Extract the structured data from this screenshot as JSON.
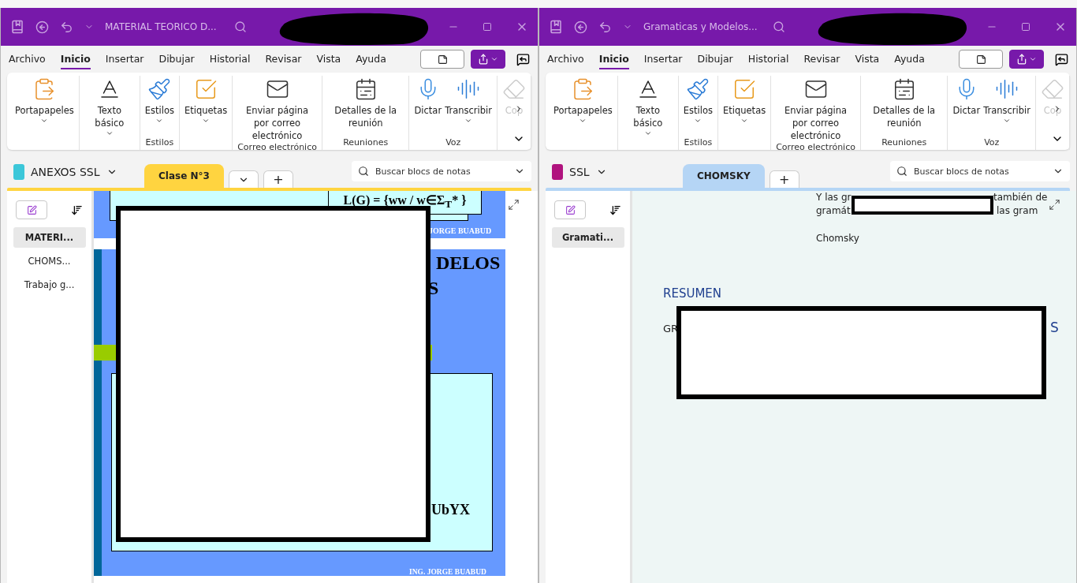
{
  "windows": [
    {
      "title": "MATERIAL TEORICO D...",
      "menu_tabs": [
        {
          "label": "Archivo",
          "selected": false
        },
        {
          "label": "Inicio",
          "selected": true
        },
        {
          "label": "Insertar",
          "selected": false
        },
        {
          "label": "Dibujar",
          "selected": false
        },
        {
          "label": "Historial",
          "selected": false
        },
        {
          "label": "Revisar",
          "selected": false
        },
        {
          "label": "Vista",
          "selected": false
        },
        {
          "label": "Ayuda",
          "selected": false
        }
      ],
      "ribbon_groups": [
        {
          "buttons": [
            {
              "kind": "clipboard",
              "label": "Portapapeles",
              "dropdown": true,
              "disabled": false
            }
          ]
        },
        {
          "buttons": [
            {
              "kind": "text",
              "label": "Texto básico",
              "dropdown": true,
              "disabled": false
            }
          ]
        },
        {
          "caption": "Estilos",
          "buttons": [
            {
              "kind": "styles",
              "label": "Estilos",
              "dropdown": true,
              "disabled": false
            }
          ]
        },
        {
          "buttons": [
            {
              "kind": "tags",
              "label": "Etiquetas",
              "dropdown": true,
              "disabled": false
            }
          ]
        },
        {
          "caption": "Correo electrónico",
          "buttons": [
            {
              "kind": "mail",
              "label": "Enviar página por correo electrónico",
              "dropdown": false,
              "disabled": false
            }
          ]
        },
        {
          "caption": "Reuniones",
          "buttons": [
            {
              "kind": "meeting",
              "label": "Detalles de la reunión",
              "dropdown": false,
              "disabled": false
            }
          ]
        },
        {
          "caption": "Voz",
          "buttons": [
            {
              "kind": "dictate",
              "label": "Dictar",
              "dropdown": false,
              "disabled": false
            },
            {
              "kind": "transcribe",
              "label": "Transcribir",
              "dropdown": true,
              "disabled": false
            }
          ]
        },
        {
          "buttons": [
            {
              "kind": "copilot",
              "label": "Cop",
              "dropdown": false,
              "disabled": true
            }
          ]
        }
      ],
      "notebook": {
        "name": "ANEXOS SSL",
        "color": "#3cc7d9"
      },
      "sections": [
        {
          "label": "Clase  N°3",
          "selected": true,
          "color": "#ffd440"
        }
      ],
      "more_sections": true,
      "add_section": "+",
      "search": {
        "placeholder": "Buscar blocs de notas"
      },
      "pages": [
        {
          "label": "MATERI...",
          "selected": true
        },
        {
          "label": "CHOMS...",
          "selected": false
        },
        {
          "label": "Trabajo g...",
          "selected": false
        }
      ],
      "page": {
        "kind": "slide",
        "texts": [
          "L(G) = {ww / w∈Σ$_{T}$* }",
          "JORGE BUABUD",
          "DELOS",
          "S",
          "UbYX",
          "ING. JORGE BUABUD"
        ]
      }
    },
    {
      "title": "Gramaticas y Modelos...",
      "menu_tabs": [
        {
          "label": "Archivo",
          "selected": false
        },
        {
          "label": "Inicio",
          "selected": true
        },
        {
          "label": "Insertar",
          "selected": false
        },
        {
          "label": "Dibujar",
          "selected": false
        },
        {
          "label": "Historial",
          "selected": false
        },
        {
          "label": "Revisar",
          "selected": false
        },
        {
          "label": "Vista",
          "selected": false
        },
        {
          "label": "Ayuda",
          "selected": false
        }
      ],
      "ribbon_groups": [
        {
          "buttons": [
            {
              "kind": "clipboard",
              "label": "Portapapeles",
              "dropdown": true,
              "disabled": false
            }
          ]
        },
        {
          "buttons": [
            {
              "kind": "text",
              "label": "Texto básico",
              "dropdown": true,
              "disabled": false
            }
          ]
        },
        {
          "caption": "Estilos",
          "buttons": [
            {
              "kind": "styles",
              "label": "Estilos",
              "dropdown": true,
              "disabled": false
            }
          ]
        },
        {
          "buttons": [
            {
              "kind": "tags",
              "label": "Etiquetas",
              "dropdown": true,
              "disabled": false
            }
          ]
        },
        {
          "caption": "Correo electrónico",
          "buttons": [
            {
              "kind": "mail",
              "label": "Enviar página por correo electrónico",
              "dropdown": false,
              "disabled": false
            }
          ]
        },
        {
          "caption": "Reuniones",
          "buttons": [
            {
              "kind": "meeting",
              "label": "Detalles de la reunión",
              "dropdown": false,
              "disabled": false
            }
          ]
        },
        {
          "caption": "Voz",
          "buttons": [
            {
              "kind": "dictate",
              "label": "Dictar",
              "dropdown": false,
              "disabled": false
            },
            {
              "kind": "transcribe",
              "label": "Transcribir",
              "dropdown": true,
              "disabled": false
            }
          ]
        },
        {
          "buttons": [
            {
              "kind": "copilot",
              "label": "Cop",
              "dropdown": false,
              "disabled": true
            }
          ]
        }
      ],
      "notebook": {
        "name": "SSL",
        "color": "#b0137e"
      },
      "sections": [
        {
          "label": "CHOMSKY",
          "selected": true,
          "color": "#b5d5f5"
        }
      ],
      "add_section": "+",
      "search": {
        "placeholder": "Buscar blocs de notas"
      },
      "pages": [
        {
          "label": "Gramati...",
          "selected": true
        }
      ],
      "page": {
        "kind": "notes",
        "texts": [
          "Y las gr",
          "también de",
          "gramát",
          "las gram",
          "Chomsky",
          "RESUMEN",
          "GR",
          "S"
        ]
      }
    }
  ]
}
